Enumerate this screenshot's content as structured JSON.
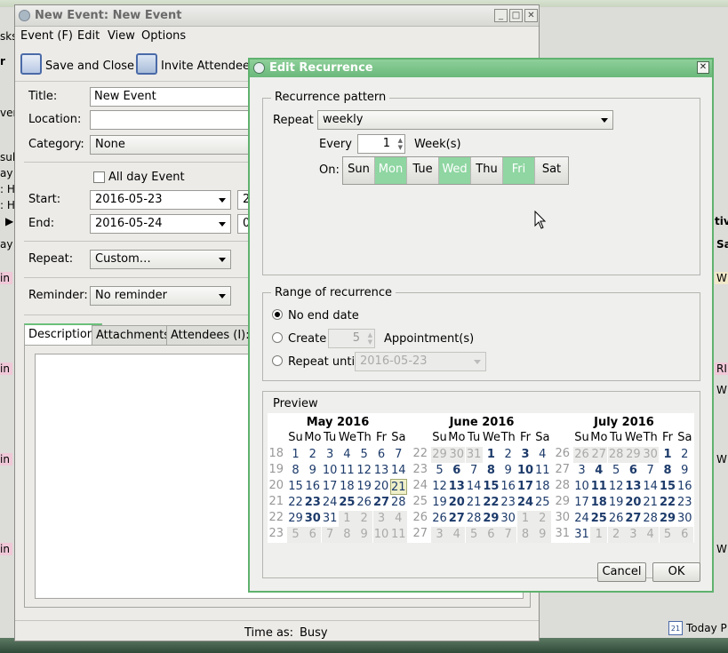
{
  "background": {
    "left_partial": [
      "sks",
      "r",
      "ver",
      "sul",
      "ay",
      ": H",
      ": H",
      "▶",
      "ay",
      "in",
      "in",
      "in",
      "in"
    ],
    "right_partial": [
      "tiv",
      "Sa",
      "W",
      "RI",
      "W",
      "W",
      "W"
    ],
    "today_label": "Today P",
    "today_icon_num": "21"
  },
  "event_window": {
    "title": "New Event: New Event",
    "menu": [
      "Event (F)",
      "Edit",
      "View",
      "Options"
    ],
    "toolbar": {
      "save_close": "Save and Close",
      "invite": "Invite Attendees"
    },
    "fields": {
      "title_label": "Title:",
      "title_value": "New Event",
      "location_label": "Location:",
      "location_value": "",
      "category_label": "Category:",
      "category_value": "None",
      "allday_label": "All day Event",
      "start_label": "Start:",
      "start_value": "2016-05-23",
      "start_time": "2",
      "end_label": "End:",
      "end_value": "2016-05-24",
      "end_time": "0",
      "repeat_label": "Repeat:",
      "repeat_value": "Custom…",
      "reminder_label": "Reminder:",
      "reminder_value": "No reminder"
    },
    "tabs": [
      "Description:",
      "Attachments:",
      "Attendees (I):"
    ],
    "status": {
      "time_as_label": "Time as:",
      "time_as_value": "Busy"
    }
  },
  "dialog": {
    "title": "Edit Recurrence",
    "pattern_legend": "Recurrence pattern",
    "repeat_label": "Repeat",
    "repeat_value": "weekly",
    "every_label": "Every",
    "every_value": "1",
    "every_unit": "Week(s)",
    "on_label": "On:",
    "days": [
      {
        "label": "Sun",
        "on": false
      },
      {
        "label": "Mon",
        "on": true
      },
      {
        "label": "Tue",
        "on": false
      },
      {
        "label": "Wed",
        "on": true
      },
      {
        "label": "Thu",
        "on": false
      },
      {
        "label": "Fri",
        "on": true
      },
      {
        "label": "Sat",
        "on": false
      }
    ],
    "range_legend": "Range of recurrence",
    "no_end": "No end date",
    "create_label": "Create",
    "create_value": "5",
    "create_unit": "Appointment(s)",
    "repeat_until_label": "Repeat until",
    "repeat_until_value": "2016-05-23",
    "preview_legend": "Preview",
    "day_headers": [
      "Su",
      "Mo",
      "Tu",
      "We",
      "Th",
      "Fr",
      "Sa"
    ],
    "months": [
      {
        "title": "May 2016",
        "weeks": [
          {
            "wk": "18",
            "days": [
              [
                "1",
                ""
              ],
              [
                "2",
                ""
              ],
              [
                "3",
                ""
              ],
              [
                "4",
                ""
              ],
              [
                "5",
                ""
              ],
              [
                "6",
                ""
              ],
              [
                "7",
                ""
              ]
            ]
          },
          {
            "wk": "19",
            "days": [
              [
                "8",
                ""
              ],
              [
                "9",
                ""
              ],
              [
                "10",
                ""
              ],
              [
                "11",
                ""
              ],
              [
                "12",
                ""
              ],
              [
                "13",
                ""
              ],
              [
                "14",
                ""
              ]
            ]
          },
          {
            "wk": "20",
            "days": [
              [
                "15",
                ""
              ],
              [
                "16",
                ""
              ],
              [
                "17",
                ""
              ],
              [
                "18",
                ""
              ],
              [
                "19",
                ""
              ],
              [
                "20",
                ""
              ],
              [
                "21",
                "today"
              ]
            ]
          },
          {
            "wk": "21",
            "days": [
              [
                "22",
                ""
              ],
              [
                "23",
                "b"
              ],
              [
                "24",
                ""
              ],
              [
                "25",
                "b"
              ],
              [
                "26",
                ""
              ],
              [
                "27",
                "b"
              ],
              [
                "28",
                ""
              ]
            ]
          },
          {
            "wk": "22",
            "days": [
              [
                "29",
                ""
              ],
              [
                "30",
                "b"
              ],
              [
                "31",
                ""
              ],
              [
                "1",
                "o"
              ],
              [
                "2",
                "o"
              ],
              [
                "3",
                "o"
              ],
              [
                "4",
                "o"
              ]
            ]
          },
          {
            "wk": "23",
            "days": [
              [
                "5",
                "o"
              ],
              [
                "6",
                "o"
              ],
              [
                "7",
                "o"
              ],
              [
                "8",
                "o"
              ],
              [
                "9",
                "o"
              ],
              [
                "10",
                "o"
              ],
              [
                "11",
                "o"
              ]
            ]
          }
        ]
      },
      {
        "title": "June 2016",
        "weeks": [
          {
            "wk": "22",
            "days": [
              [
                "29",
                "o"
              ],
              [
                "30",
                "o"
              ],
              [
                "31",
                "o"
              ],
              [
                "1",
                "b"
              ],
              [
                "2",
                ""
              ],
              [
                "3",
                "b"
              ],
              [
                "4",
                ""
              ]
            ]
          },
          {
            "wk": "23",
            "days": [
              [
                "5",
                ""
              ],
              [
                "6",
                "b"
              ],
              [
                "7",
                ""
              ],
              [
                "8",
                "b"
              ],
              [
                "9",
                ""
              ],
              [
                "10",
                "b"
              ],
              [
                "11",
                ""
              ]
            ]
          },
          {
            "wk": "24",
            "days": [
              [
                "12",
                ""
              ],
              [
                "13",
                "b"
              ],
              [
                "14",
                ""
              ],
              [
                "15",
                "b"
              ],
              [
                "16",
                ""
              ],
              [
                "17",
                "b"
              ],
              [
                "18",
                ""
              ]
            ]
          },
          {
            "wk": "25",
            "days": [
              [
                "19",
                ""
              ],
              [
                "20",
                "b"
              ],
              [
                "21",
                ""
              ],
              [
                "22",
                "b"
              ],
              [
                "23",
                ""
              ],
              [
                "24",
                "b"
              ],
              [
                "25",
                ""
              ]
            ]
          },
          {
            "wk": "26",
            "days": [
              [
                "26",
                ""
              ],
              [
                "27",
                "b"
              ],
              [
                "28",
                ""
              ],
              [
                "29",
                "b"
              ],
              [
                "30",
                ""
              ],
              [
                "1",
                "o"
              ],
              [
                "2",
                "o"
              ]
            ]
          },
          {
            "wk": "27",
            "days": [
              [
                "3",
                "o"
              ],
              [
                "4",
                "o"
              ],
              [
                "5",
                "o"
              ],
              [
                "6",
                "o"
              ],
              [
                "7",
                "o"
              ],
              [
                "8",
                "o"
              ],
              [
                "9",
                "o"
              ]
            ]
          }
        ]
      },
      {
        "title": "July 2016",
        "weeks": [
          {
            "wk": "26",
            "days": [
              [
                "26",
                "o"
              ],
              [
                "27",
                "o"
              ],
              [
                "28",
                "o"
              ],
              [
                "29",
                "o"
              ],
              [
                "30",
                "o"
              ],
              [
                "1",
                "b"
              ],
              [
                "2",
                ""
              ]
            ]
          },
          {
            "wk": "27",
            "days": [
              [
                "3",
                ""
              ],
              [
                "4",
                "b"
              ],
              [
                "5",
                ""
              ],
              [
                "6",
                "b"
              ],
              [
                "7",
                ""
              ],
              [
                "8",
                "b"
              ],
              [
                "9",
                ""
              ]
            ]
          },
          {
            "wk": "28",
            "days": [
              [
                "10",
                ""
              ],
              [
                "11",
                "b"
              ],
              [
                "12",
                ""
              ],
              [
                "13",
                "b"
              ],
              [
                "14",
                ""
              ],
              [
                "15",
                "b"
              ],
              [
                "16",
                ""
              ]
            ]
          },
          {
            "wk": "29",
            "days": [
              [
                "17",
                ""
              ],
              [
                "18",
                "b"
              ],
              [
                "19",
                ""
              ],
              [
                "20",
                "b"
              ],
              [
                "21",
                ""
              ],
              [
                "22",
                "b"
              ],
              [
                "23",
                ""
              ]
            ]
          },
          {
            "wk": "30",
            "days": [
              [
                "24",
                ""
              ],
              [
                "25",
                "b"
              ],
              [
                "26",
                ""
              ],
              [
                "27",
                "b"
              ],
              [
                "28",
                ""
              ],
              [
                "29",
                "b"
              ],
              [
                "30",
                ""
              ]
            ]
          },
          {
            "wk": "31",
            "days": [
              [
                "31",
                ""
              ],
              [
                "1",
                "o"
              ],
              [
                "2",
                "o"
              ],
              [
                "3",
                "o"
              ],
              [
                "4",
                "o"
              ],
              [
                "5",
                "o"
              ],
              [
                "6",
                "o"
              ]
            ]
          }
        ]
      }
    ],
    "cancel": "Cancel",
    "ok": "OK"
  }
}
